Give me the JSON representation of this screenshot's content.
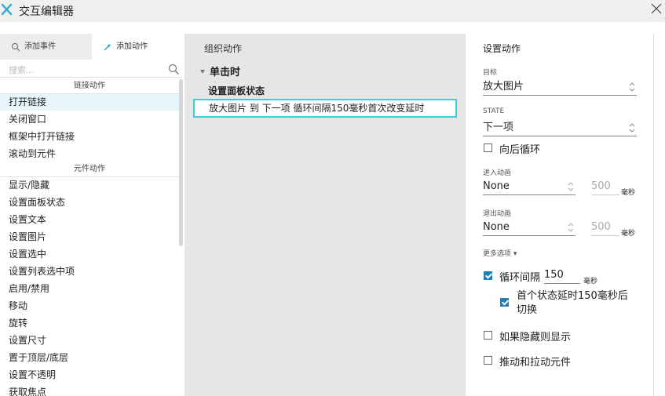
{
  "window": {
    "title": "交互编辑器"
  },
  "left": {
    "tabs": {
      "add_event": "添加事件",
      "add_action": "添加动作"
    },
    "search_placeholder": "搜索...",
    "link_section": "链接动作",
    "link_items": [
      "打开链接",
      "关闭窗口",
      "框架中打开链接",
      "滚动到元件"
    ],
    "widget_section": "元件动作",
    "widget_items": [
      "显示/隐藏",
      "设置面板状态",
      "设置文本",
      "设置图片",
      "设置选中",
      "设置列表选中项",
      "启用/禁用",
      "移动",
      "旋转",
      "设置尺寸",
      "置于顶层/底层",
      "设置不透明",
      "获取焦点"
    ]
  },
  "middle": {
    "title": "组织动作",
    "event": "单击时",
    "case": "设置面板状态",
    "action": "放大图片 到 下一项 循环间隔150毫秒首次改变延时"
  },
  "right": {
    "title": "设置动作",
    "target_label": "目标",
    "target_value": "放大图片",
    "state_label": "STATE",
    "state_value": "下一项",
    "wrap_label": "向后循环",
    "enter_label": "进入动画",
    "enter_value": "None",
    "enter_ms": "500",
    "exit_label": "退出动画",
    "exit_value": "None",
    "exit_ms": "500",
    "ms_unit": "毫秒",
    "more_options": "更多选项 ▾",
    "repeat_label": "循环间隔",
    "repeat_value": "150",
    "first_delay_label_1": "首个状态延时150毫秒后",
    "first_delay_label_2": "切换",
    "show_if_hidden": "如果隐藏则显示",
    "push_pull": "推动和拉动元件"
  },
  "colors": {
    "accent": "#3dcbd6",
    "checkbox": "#1e7fb8",
    "selected_row": "#e6f6fa"
  }
}
